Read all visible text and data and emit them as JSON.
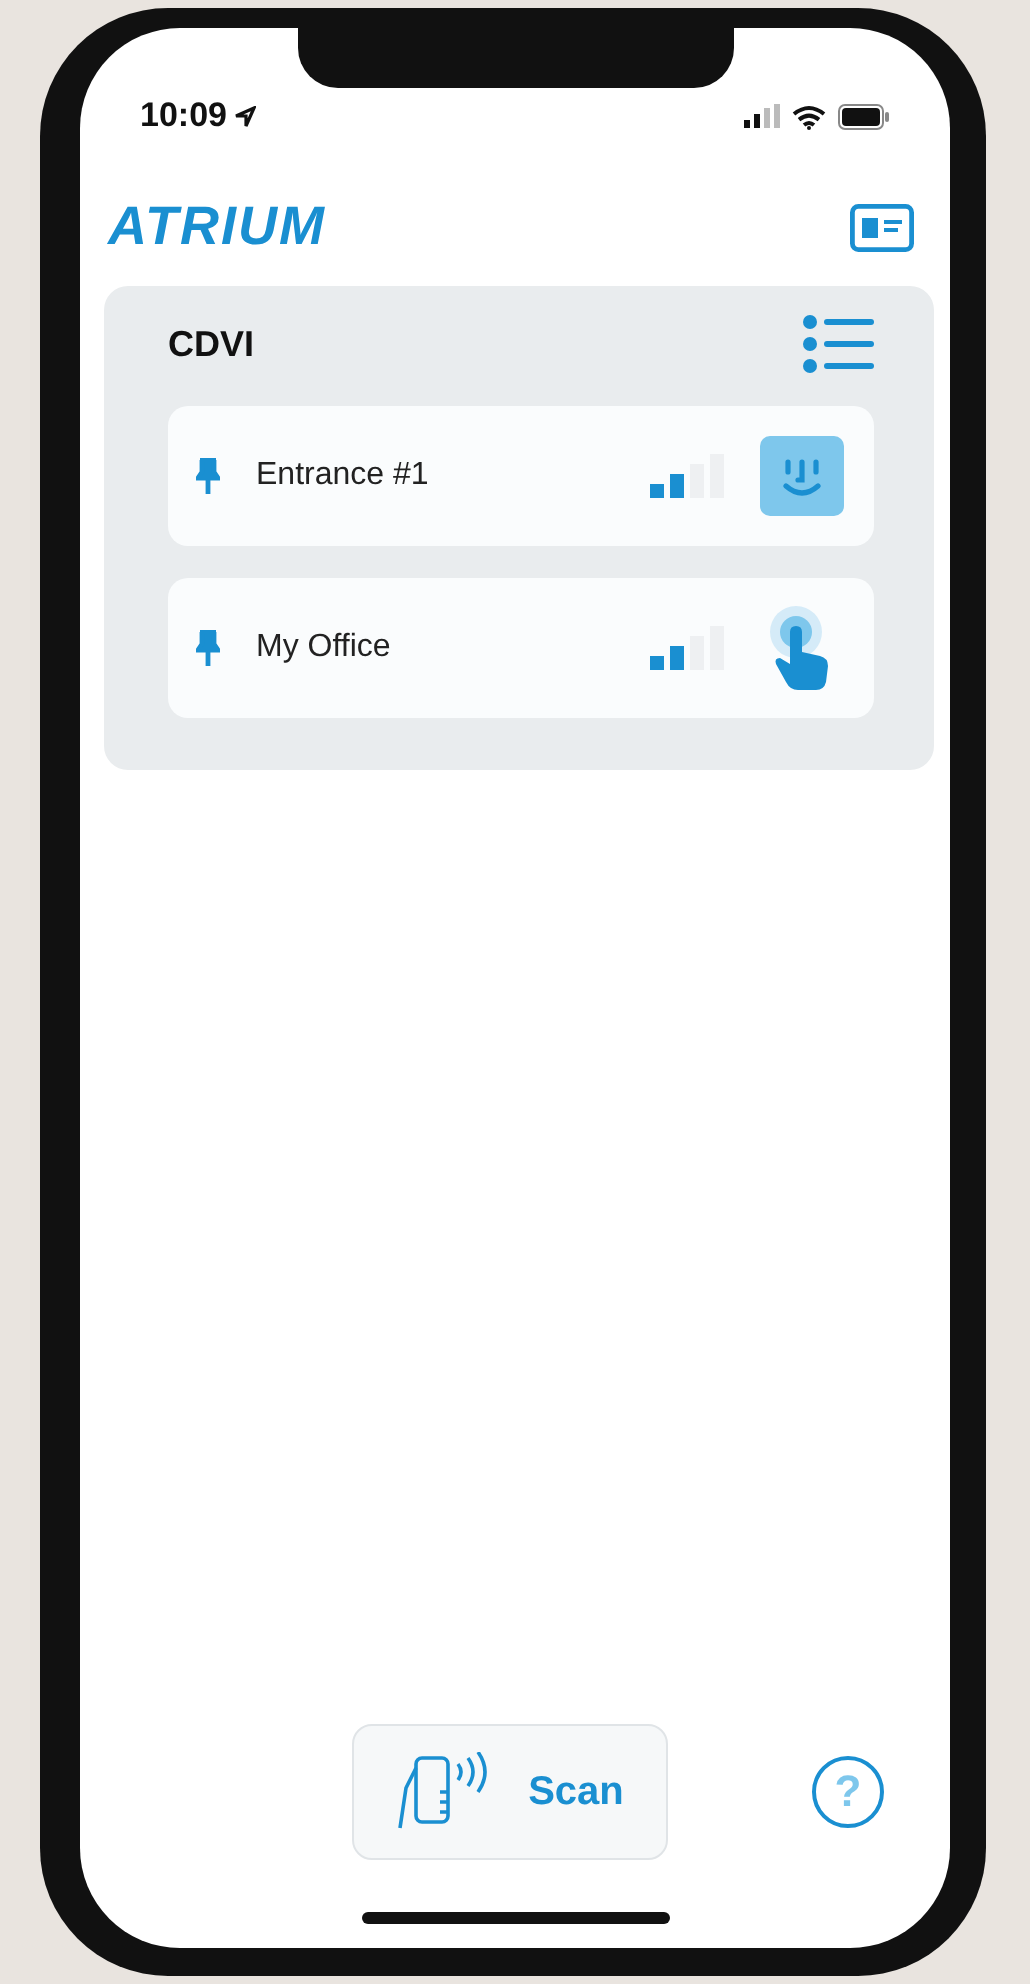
{
  "status_bar": {
    "time": "10:09"
  },
  "header": {
    "logo": "ATRIUM"
  },
  "group": {
    "title": "CDVI",
    "doors": [
      {
        "name": "Entrance #1",
        "kind": "face"
      },
      {
        "name": "My Office",
        "kind": "touch"
      }
    ]
  },
  "scan_button": {
    "label": "Scan"
  },
  "help_button": {
    "label": "?"
  }
}
